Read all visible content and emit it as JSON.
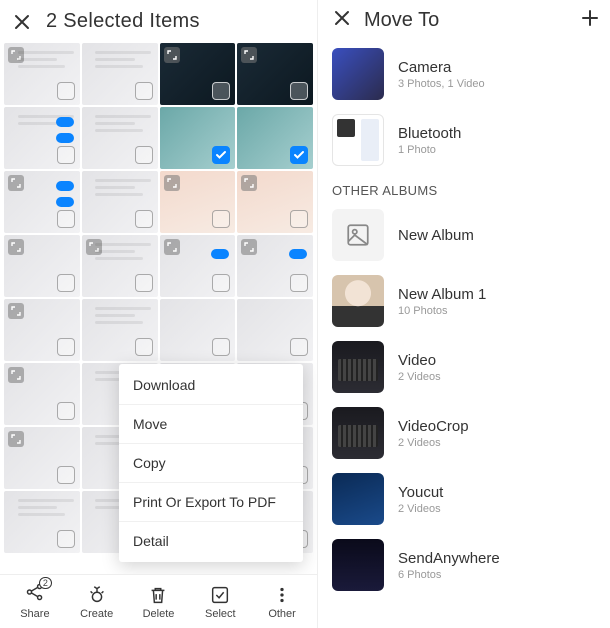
{
  "left": {
    "title": "2 Selected Items",
    "menu": {
      "download": "Download",
      "move": "Move",
      "copy": "Copy",
      "print": "Print Or Export To PDF",
      "detail": "Detail"
    },
    "bottombar": {
      "share": "Share",
      "share_badge": "2",
      "create": "Create",
      "delete": "Delete",
      "select": "Select",
      "other": "Other"
    }
  },
  "right": {
    "title": "Move To",
    "section_other": "OTHER ALBUMS",
    "albums": {
      "camera": {
        "name": "Camera",
        "meta": "3 Photos, 1 Video"
      },
      "bluetooth": {
        "name": "Bluetooth",
        "meta": "1 Photo"
      },
      "newalbum": {
        "name": "New Album"
      },
      "newalbum1": {
        "name": "New Album 1",
        "meta": "10 Photos"
      },
      "video": {
        "name": "Video",
        "meta": "2 Videos"
      },
      "videocrop": {
        "name": "VideoCrop",
        "meta": "2 Videos"
      },
      "youcut": {
        "name": "Youcut",
        "meta": "2 Videos"
      },
      "sendanywhere": {
        "name": "SendAnywhere",
        "meta": "6 Photos"
      }
    }
  }
}
